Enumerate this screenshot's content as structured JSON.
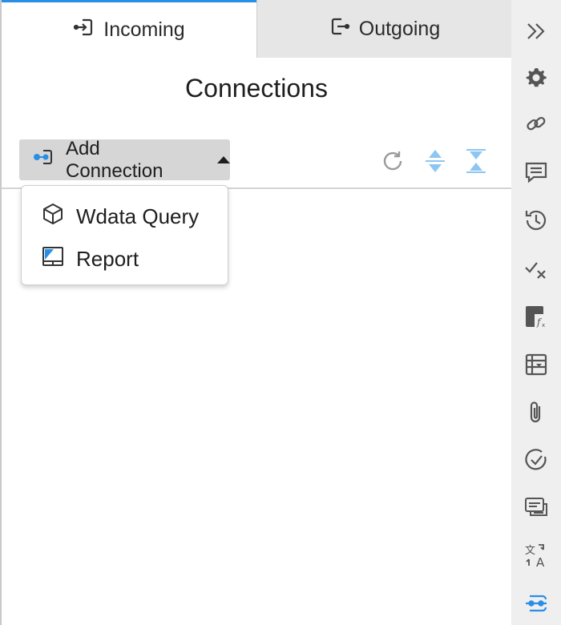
{
  "tabs": [
    {
      "label": "Incoming",
      "icon": "incoming-icon",
      "active": true
    },
    {
      "label": "Outgoing",
      "icon": "outgoing-icon",
      "active": false
    }
  ],
  "title": "Connections",
  "toolbar": {
    "add_label": "Add Connection",
    "icons": [
      "refresh-icon",
      "expand-all-icon",
      "collapse-all-icon"
    ]
  },
  "dropdown": {
    "items": [
      {
        "label": "Wdata Query",
        "icon": "cube-icon"
      },
      {
        "label": "Report",
        "icon": "report-icon"
      }
    ]
  },
  "rail": {
    "icons": [
      "collapse-panel-icon",
      "gear-icon",
      "link-icon",
      "comment-icon",
      "history-icon",
      "check-x-icon",
      "formula-icon",
      "table-icon",
      "paperclip-icon",
      "check-circle-icon",
      "notes-icon",
      "translate-icon",
      "connections-icon"
    ],
    "active": "connections-icon"
  },
  "colors": {
    "accent": "#2a8ee6",
    "toolbar_icon": "#8dc6f2",
    "rail_bg": "#efefef",
    "button_bg": "#d6d6d6"
  }
}
